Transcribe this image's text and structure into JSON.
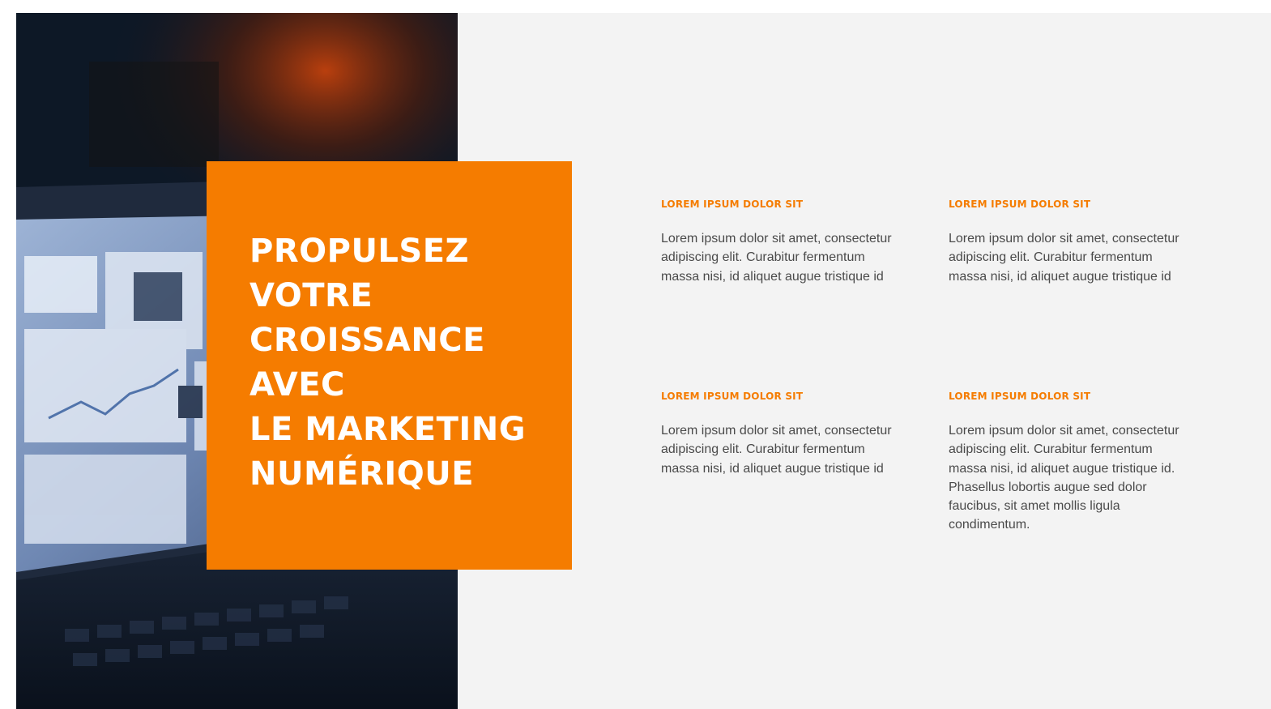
{
  "hero": {
    "title": "PROPULSEZ\nVOTRE\nCROISSANCE\nAVEC\nLE MARKETING\nNUMÉRIQUE",
    "image": "laptop-analytics-dashboard-photo"
  },
  "features": [
    {
      "heading": "LOREM IPSUM DOLOR SIT",
      "body": "Lorem ipsum dolor sit amet, consectetur adipiscing elit. Curabitur fermentum massa nisi, id aliquet augue tristique id"
    },
    {
      "heading": "LOREM IPSUM DOLOR SIT",
      "body": "Lorem ipsum dolor sit amet, consectetur adipiscing elit. Curabitur fermentum massa nisi, id aliquet augue tristique id"
    },
    {
      "heading": "LOREM IPSUM DOLOR SIT",
      "body": "Lorem ipsum dolor sit amet, consectetur adipiscing elit. Curabitur fermentum massa nisi, id aliquet augue tristique id"
    },
    {
      "heading": "LOREM IPSUM DOLOR SIT",
      "body": "Lorem ipsum dolor sit amet, consectetur adipiscing elit. Curabitur fermentum massa nisi, id aliquet augue tristique id.  Phasellus lobortis augue sed dolor faucibus, sit amet mollis ligula condimentum."
    }
  ],
  "colors": {
    "accent": "#f57c00",
    "background": "#f3f3f3",
    "body_text": "#4a4a4a"
  }
}
